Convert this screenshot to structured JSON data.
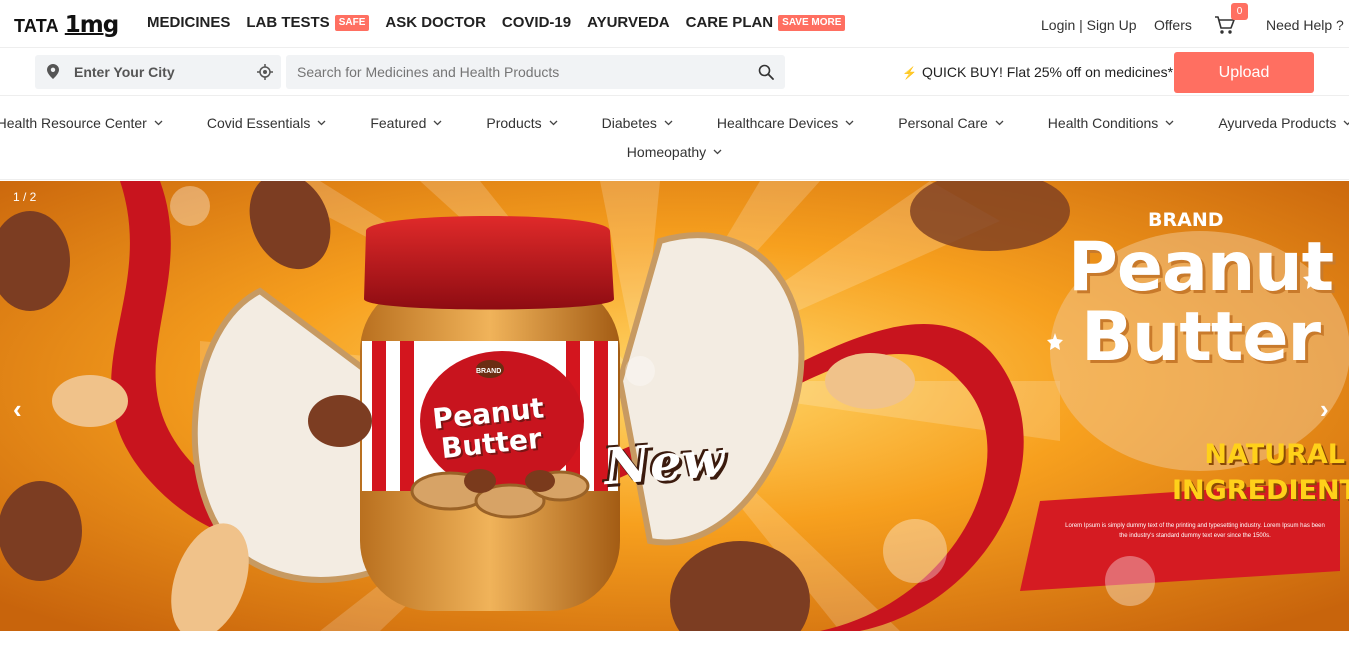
{
  "brand": {
    "part1": "TATA",
    "part2": "1mg"
  },
  "nav": [
    {
      "label": "MEDICINES",
      "badge": ""
    },
    {
      "label": "LAB TESTS",
      "badge": "SAFE"
    },
    {
      "label": "ASK DOCTOR",
      "badge": ""
    },
    {
      "label": "COVID-19",
      "badge": ""
    },
    {
      "label": "AYURVEDA",
      "badge": ""
    },
    {
      "label": "CARE PLAN",
      "badge": "SAVE MORE"
    }
  ],
  "header_right": {
    "login": "Login | Sign Up",
    "offers": "Offers",
    "cart_count": "0",
    "help": "Need Help ?"
  },
  "search": {
    "city_placeholder": "Enter Your City",
    "placeholder": "Search for Medicines and Health Products",
    "quick_buy": "QUICK BUY! Flat 25% off on medicines*",
    "upload": "Upload"
  },
  "categories": [
    "Health Resource Center",
    "Covid Essentials",
    "Featured",
    "Products",
    "Diabetes",
    "Healthcare Devices",
    "Personal Care",
    "Health Conditions",
    "Ayurveda Products",
    "Homeopathy"
  ],
  "banner": {
    "slide_counter": "1 / 2",
    "prev": "‹",
    "next": "›",
    "brand": "BRAND",
    "title_line1": "Peanut",
    "title_line2": "Butter",
    "tag_line1": "NATURAL",
    "tag_line2": "INGREDIENTS",
    "fine_print": "Lorem Ipsum is simply dummy text of the printing and typesetting industry. Lorem Ipsum has been the industry's standard dummy text ever since the 1500s.",
    "jar_brand": "BRAND",
    "jar_title_line1": "Peanut",
    "jar_title_line2": "Butter",
    "jar_new": "New"
  },
  "colors": {
    "accent": "#ff6f61",
    "banner_orange": "#f7a01e",
    "ribbon_red": "#c8141e"
  }
}
